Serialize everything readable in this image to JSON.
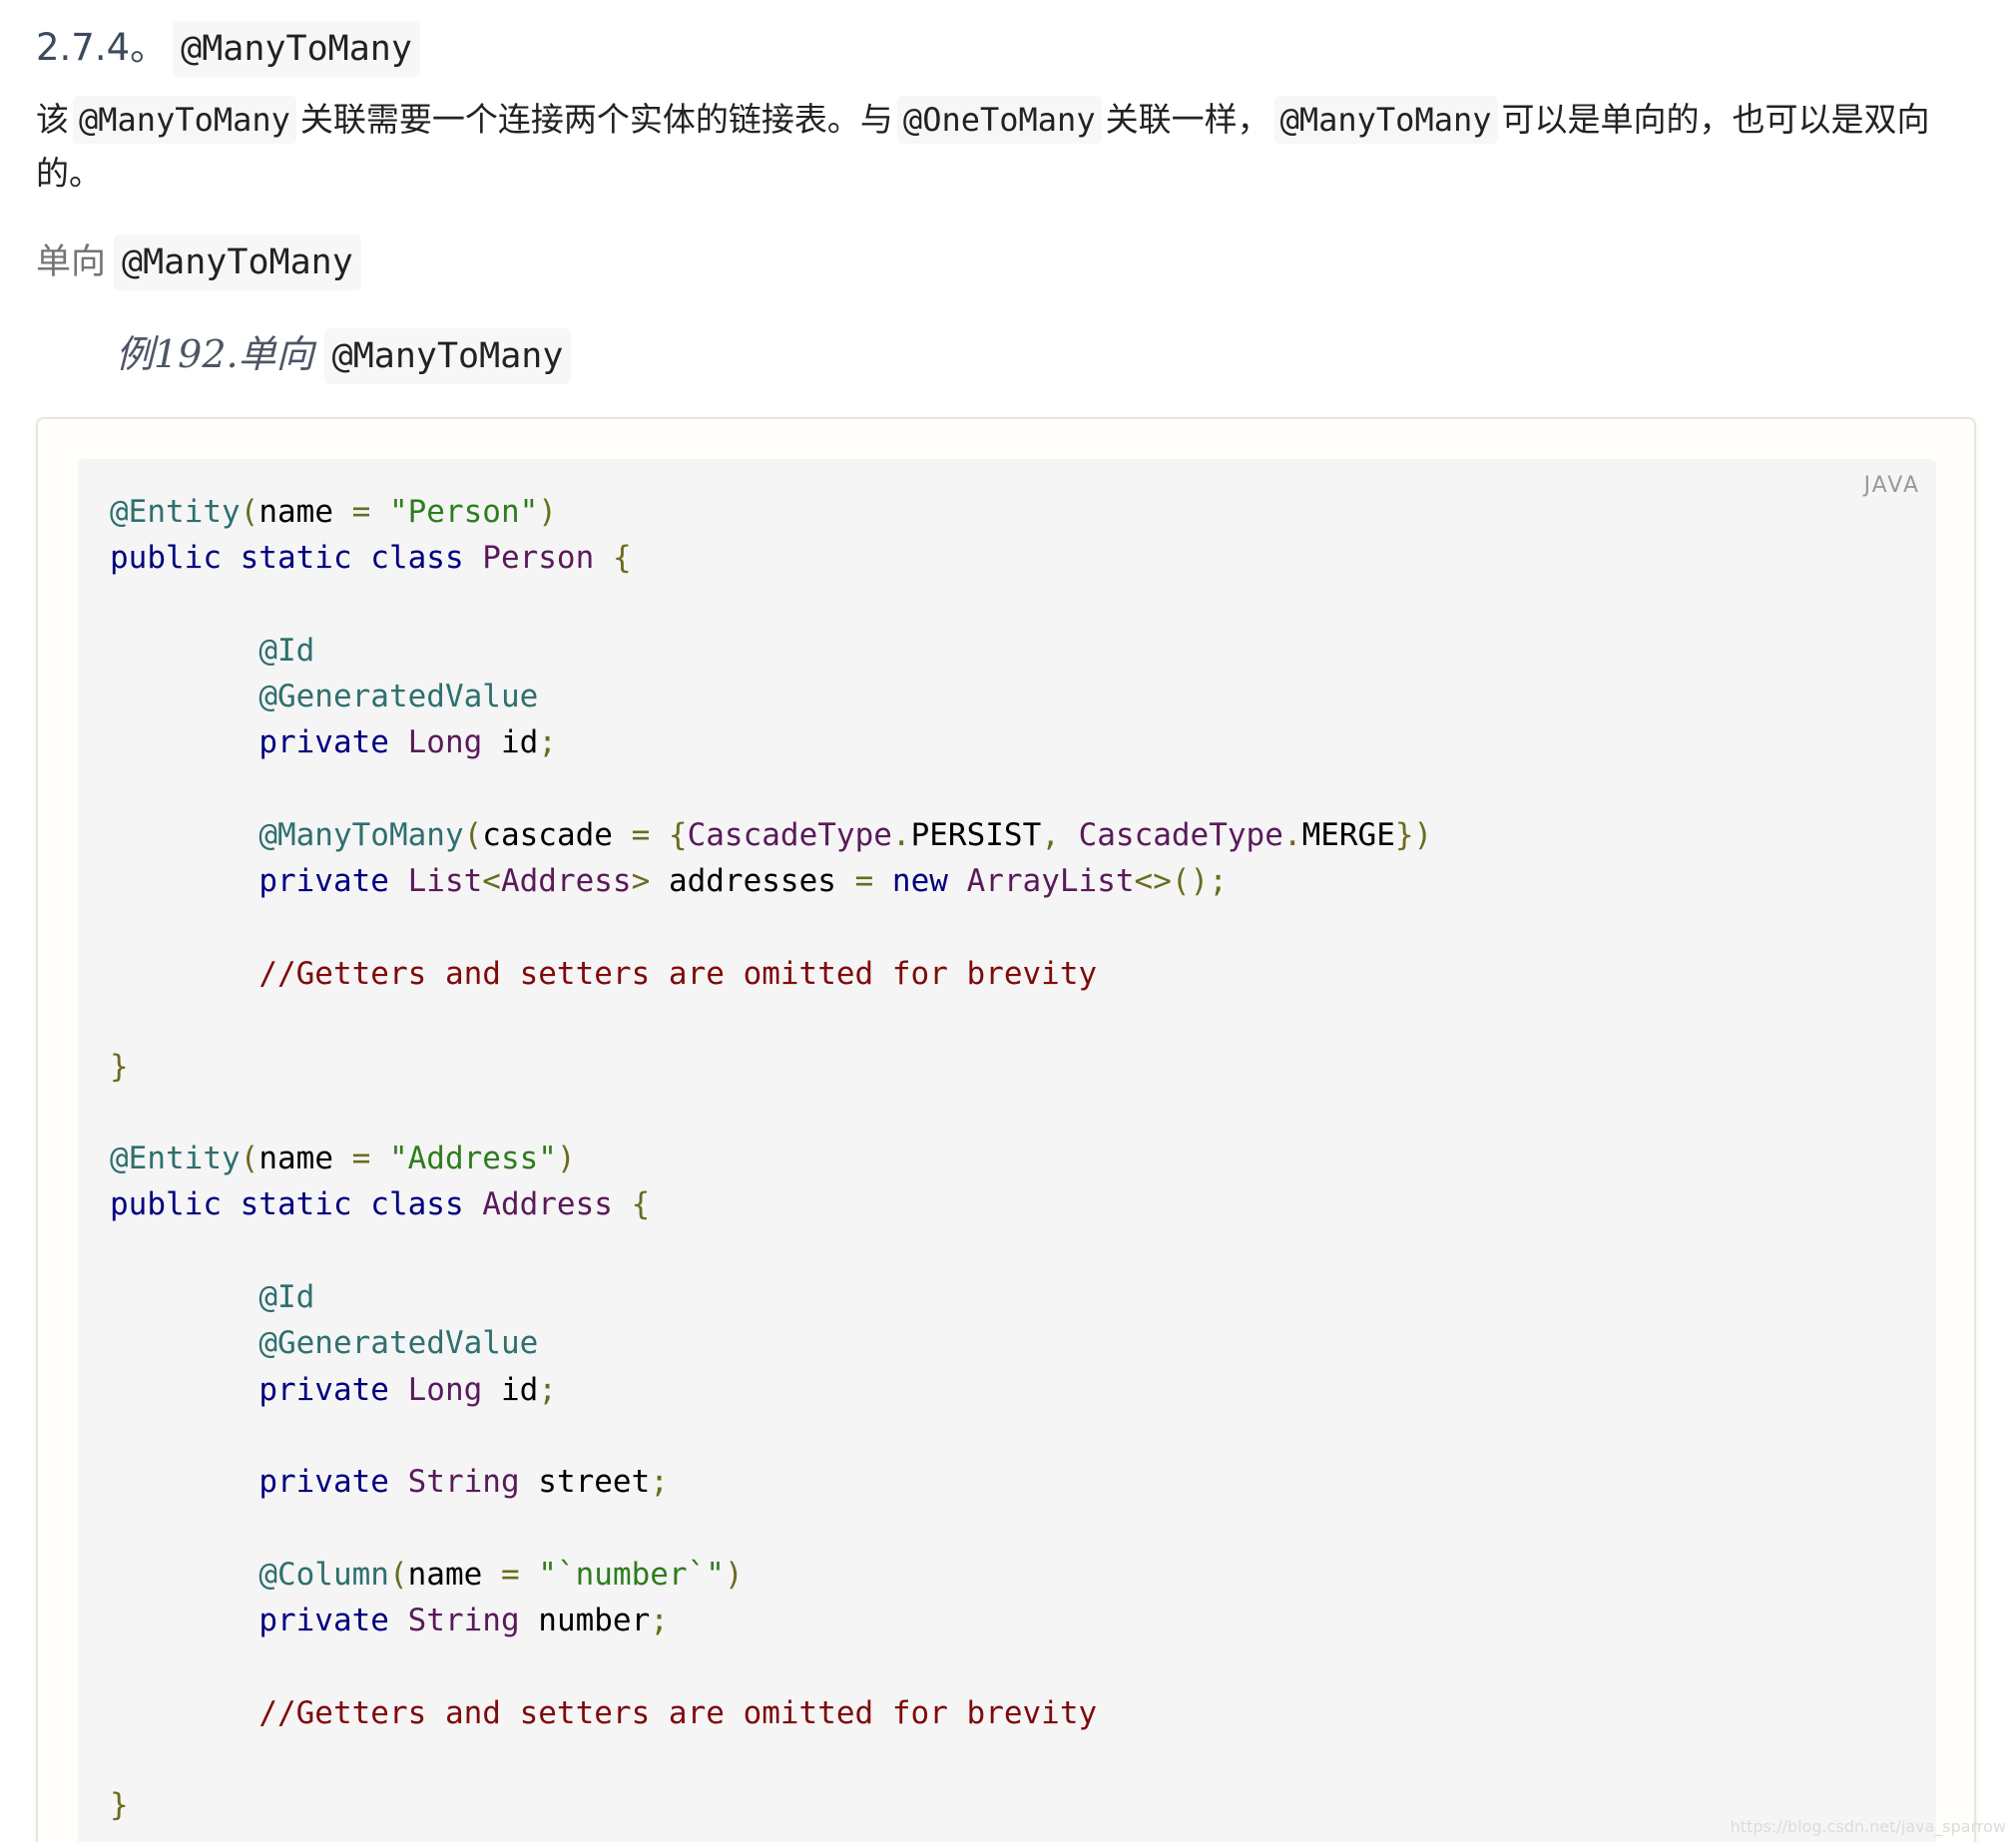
{
  "heading": {
    "number": "2.7.4。",
    "code": "@ManyToMany"
  },
  "intro": {
    "t1": "该",
    "c1": "@ManyToMany",
    "t2": "关联需要一个连接两个实体的链接表。与",
    "c2": "@OneToMany",
    "t3": "关联一样，",
    "c3": "@ManyToMany",
    "t4": "可以是单向的，也可以是双向的。"
  },
  "subheading": {
    "label": "单向",
    "code": "@ManyToMany"
  },
  "example": {
    "title": "例192.单向",
    "code": "@ManyToMany",
    "language": "JAVA"
  },
  "code_lines": [
    [
      [
        "ann",
        "@Entity"
      ],
      [
        "pn",
        "("
      ],
      [
        "id",
        "name "
      ],
      [
        "pn",
        "= "
      ],
      [
        "str",
        "\"Person\""
      ],
      [
        "pn",
        ")"
      ]
    ],
    [
      [
        "kw",
        "public static class "
      ],
      [
        "ty",
        "Person "
      ],
      [
        "pn",
        "{"
      ]
    ],
    [],
    [
      [
        "id",
        "        "
      ],
      [
        "ann",
        "@Id"
      ]
    ],
    [
      [
        "id",
        "        "
      ],
      [
        "ann",
        "@GeneratedValue"
      ]
    ],
    [
      [
        "id",
        "        "
      ],
      [
        "kw",
        "private "
      ],
      [
        "ty",
        "Long "
      ],
      [
        "id",
        "id"
      ],
      [
        "pn",
        ";"
      ]
    ],
    [],
    [
      [
        "id",
        "        "
      ],
      [
        "ann",
        "@ManyToMany"
      ],
      [
        "pn",
        "("
      ],
      [
        "id",
        "cascade "
      ],
      [
        "pn",
        "= {"
      ],
      [
        "ty",
        "CascadeType"
      ],
      [
        "pn",
        "."
      ],
      [
        "id",
        "PERSIST"
      ],
      [
        "pn",
        ", "
      ],
      [
        "ty",
        "CascadeType"
      ],
      [
        "pn",
        "."
      ],
      [
        "id",
        "MERGE"
      ],
      [
        "pn",
        "})"
      ]
    ],
    [
      [
        "id",
        "        "
      ],
      [
        "kw",
        "private "
      ],
      [
        "ty",
        "List"
      ],
      [
        "pn",
        "<"
      ],
      [
        "ty",
        "Address"
      ],
      [
        "pn",
        "> "
      ],
      [
        "id",
        "addresses "
      ],
      [
        "pn",
        "= "
      ],
      [
        "kw",
        "new "
      ],
      [
        "ty",
        "ArrayList"
      ],
      [
        "pn",
        "<>();"
      ]
    ],
    [],
    [
      [
        "id",
        "        "
      ],
      [
        "com",
        "//Getters and setters are omitted for brevity"
      ]
    ],
    [],
    [
      [
        "pn",
        "}"
      ]
    ],
    [],
    [
      [
        "ann",
        "@Entity"
      ],
      [
        "pn",
        "("
      ],
      [
        "id",
        "name "
      ],
      [
        "pn",
        "= "
      ],
      [
        "str",
        "\"Address\""
      ],
      [
        "pn",
        ")"
      ]
    ],
    [
      [
        "kw",
        "public static class "
      ],
      [
        "ty",
        "Address "
      ],
      [
        "pn",
        "{"
      ]
    ],
    [],
    [
      [
        "id",
        "        "
      ],
      [
        "ann",
        "@Id"
      ]
    ],
    [
      [
        "id",
        "        "
      ],
      [
        "ann",
        "@GeneratedValue"
      ]
    ],
    [
      [
        "id",
        "        "
      ],
      [
        "kw",
        "private "
      ],
      [
        "ty",
        "Long "
      ],
      [
        "id",
        "id"
      ],
      [
        "pn",
        ";"
      ]
    ],
    [],
    [
      [
        "id",
        "        "
      ],
      [
        "kw",
        "private "
      ],
      [
        "ty",
        "String "
      ],
      [
        "id",
        "street"
      ],
      [
        "pn",
        ";"
      ]
    ],
    [],
    [
      [
        "id",
        "        "
      ],
      [
        "ann",
        "@Column"
      ],
      [
        "pn",
        "("
      ],
      [
        "id",
        "name "
      ],
      [
        "pn",
        "= "
      ],
      [
        "str",
        "\"`number`\""
      ],
      [
        "pn",
        ")"
      ]
    ],
    [
      [
        "id",
        "        "
      ],
      [
        "kw",
        "private "
      ],
      [
        "ty",
        "String "
      ],
      [
        "id",
        "number"
      ],
      [
        "pn",
        ";"
      ]
    ],
    [],
    [
      [
        "id",
        "        "
      ],
      [
        "com",
        "//Getters and setters are omitted for brevity"
      ]
    ],
    [],
    [
      [
        "pn",
        "}"
      ]
    ]
  ],
  "watermark": "https://blog.csdn.net/java_sparrow",
  "colors": {
    "annotation": "#2f6f6f",
    "keyword": "#00007f",
    "type": "#5a1a5a",
    "string": "#2e7d1e",
    "punctuation": "#6b6b1f",
    "comment": "#7f0a0a",
    "code_background": "#f5f5f5",
    "heading": "#3c4a5e"
  }
}
